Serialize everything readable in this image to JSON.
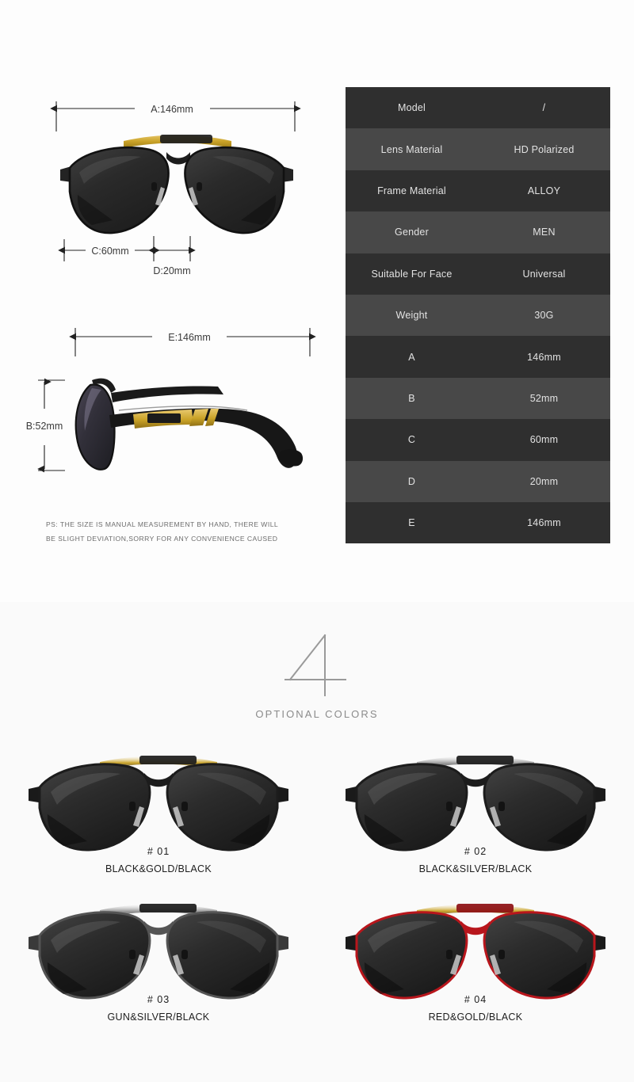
{
  "specs": {
    "rows": [
      {
        "key": "Model",
        "value": "/"
      },
      {
        "key": "Lens Material",
        "value": "HD Polarized"
      },
      {
        "key": "Frame Material",
        "value": "ALLOY"
      },
      {
        "key": "Gender",
        "value": "MEN"
      },
      {
        "key": "Suitable For Face",
        "value": "Universal"
      },
      {
        "key": "Weight",
        "value": "30G"
      },
      {
        "key": "A",
        "value": "146mm"
      },
      {
        "key": "B",
        "value": "52mm"
      },
      {
        "key": "C",
        "value": "60mm"
      },
      {
        "key": "D",
        "value": "20mm"
      },
      {
        "key": "E",
        "value": "146mm"
      }
    ]
  },
  "diagram": {
    "front": {
      "width_label": "A:146mm",
      "lens_label": "C:60mm",
      "bridge_label": "D:20mm"
    },
    "side": {
      "temple_label": "E:146mm",
      "height_label": "B:52mm"
    },
    "note_line1": "PS: THE SIZE IS MANUAL MEASUREMENT BY HAND, THERE WILL",
    "note_line2": "BE SLIGHT DEVIATION,SORRY FOR ANY CONVENIENCE CAUSED"
  },
  "colors": {
    "count": "4",
    "subtitle": "OPTIONAL COLORS",
    "variants": [
      {
        "code": "#  01",
        "name": "BLACK&GOLD/BLACK",
        "frame": "#1c1c1c",
        "brow": "#c9a227",
        "lens": "#2c2c2c",
        "temple": "#1a1a1a"
      },
      {
        "code": "#  02",
        "name": "BLACK&SILVER/BLACK",
        "frame": "#1c1c1c",
        "brow": "#9d9d9d",
        "lens": "#2c2c2c",
        "temple": "#1a1a1a"
      },
      {
        "code": "#  03",
        "name": "GUN&SILVER/BLACK",
        "frame": "#545454",
        "brow": "#9d9d9d",
        "lens": "#2c2c2c",
        "temple": "#3a3a3a"
      },
      {
        "code": "#  04",
        "name": "RED&GOLD/BLACK",
        "frame": "#b8161c",
        "brow": "#c9a227",
        "lens": "#2c2c2c",
        "temple": "#1a1a1a"
      }
    ]
  },
  "theme": {
    "page_bg": "#fdfdfd",
    "table_row_dark": "#2f2f2f",
    "table_row_light": "#484848",
    "table_text": "#e2e2e2",
    "dim_line": "#222222",
    "note_text": "#6d6d6d"
  }
}
